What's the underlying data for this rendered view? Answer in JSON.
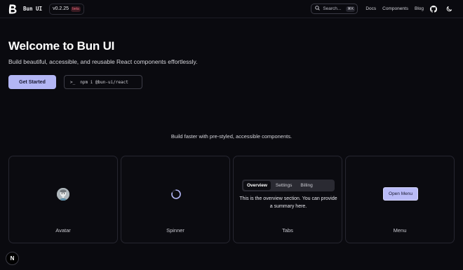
{
  "header": {
    "brand": "Bun UI",
    "version": "v0.2.25",
    "badge": "beta",
    "search_placeholder": "Search...",
    "search_shortcut": "⌘K",
    "nav": [
      "Docs",
      "Components",
      "Blog"
    ],
    "icons": {
      "logo": "bun-logo-icon",
      "github": "github-icon",
      "theme": "moon-icon"
    }
  },
  "hero": {
    "title": "Welcome to Bun UI",
    "subtitle": "Build beautiful, accessible, and reusable React components effortlessly.",
    "primary_button": "Get Started",
    "command_prompt": ">_",
    "command": "npm i @bun-ui/react"
  },
  "tagline": "Build faster with pre-styled, accessible components.",
  "cards": [
    {
      "label": "Avatar"
    },
    {
      "label": "Spinner"
    },
    {
      "label": "Tabs",
      "tabs": [
        "Overview",
        "Settings",
        "Billing"
      ],
      "active_tab": "Overview",
      "content": "This is the overview section. You can provide a summary here."
    },
    {
      "label": "Menu",
      "button": "Open Menu"
    }
  ],
  "corner_badge": "N",
  "colors": {
    "background": "#0a0a0f",
    "accent": "#b3b6f5",
    "beta_badge": "#f06b7e"
  }
}
